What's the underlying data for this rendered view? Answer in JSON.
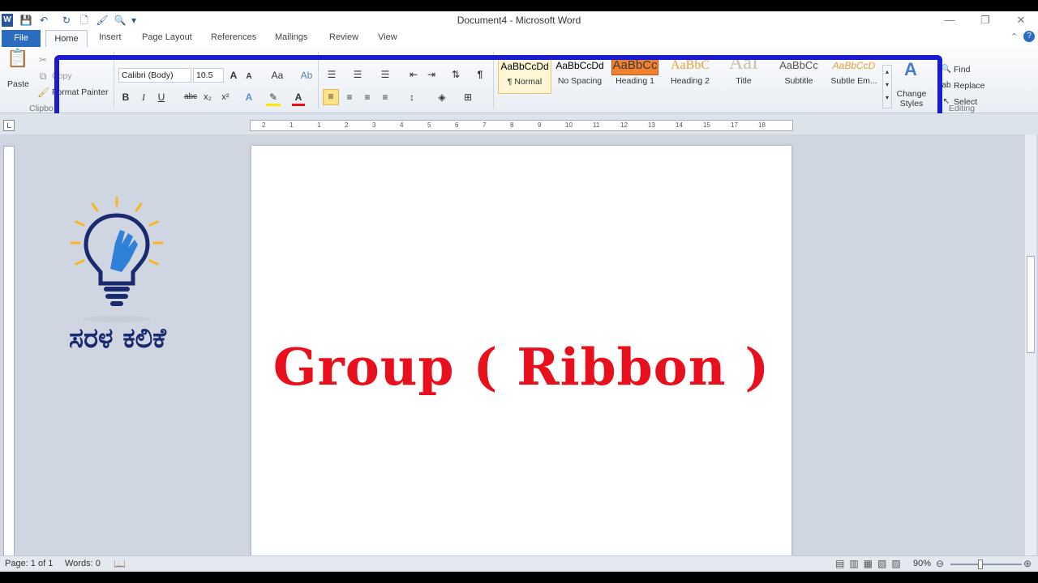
{
  "title": "Document4 - Microsoft Word",
  "tabs": {
    "file": "File",
    "home": "Home",
    "insert": "Insert",
    "page_layout": "Page Layout",
    "references": "References",
    "mailings": "Mailings",
    "review": "Review",
    "view": "View"
  },
  "clipboard": {
    "paste": "Paste",
    "cut": "Cut",
    "copy": "Copy",
    "format_painter": "Format Painter",
    "group": "Clipbo"
  },
  "font": {
    "family": "Calibri (Body)",
    "size": "10.5",
    "bold": "B",
    "italic": "I",
    "underline": "U",
    "strike": "abc",
    "sub": "x₂",
    "sup": "x²",
    "grow": "A",
    "shrink": "A",
    "case": "Aa"
  },
  "styles": [
    {
      "preview": "AaBbCcDd",
      "name": "¶ Normal",
      "color": "#000000"
    },
    {
      "preview": "AaBbCcDd",
      "name": "No Spacing",
      "color": "#000000"
    },
    {
      "preview": "AaBbCc",
      "name": "Heading 1",
      "color": "#3b3b3b"
    },
    {
      "preview": "AaBbC",
      "name": "Heading 2",
      "color": "#e8a33b"
    },
    {
      "preview": "AaI",
      "name": "Title",
      "color": "#8a8a8a"
    },
    {
      "preview": "AaBbCc",
      "name": "Subtitle",
      "color": "#555555"
    },
    {
      "preview": "AaBbCcD",
      "name": "Subtle Em...",
      "color": "#e8a33b"
    }
  ],
  "change_styles": "Change Styles",
  "editing": {
    "find": "Find",
    "replace": "Replace",
    "select": "Select",
    "group": "Editing"
  },
  "ruler_numbers": [
    "2",
    "1",
    "1",
    "2",
    "3",
    "4",
    "5",
    "6",
    "7",
    "8",
    "9",
    "10",
    "11",
    "12",
    "13",
    "14",
    "15",
    "17",
    "18"
  ],
  "document": {
    "heading": "Group ( Ribbon )"
  },
  "logo": {
    "text": "ಸರಳ ಕಲಿಕೆ"
  },
  "status": {
    "page": "Page: 1 of 1",
    "words": "Words: 0",
    "zoom": "90%"
  },
  "colors": {
    "highlight": "#1b1bd0",
    "heading_text": "#e8101c",
    "file_tab": "#2b6cc0"
  }
}
